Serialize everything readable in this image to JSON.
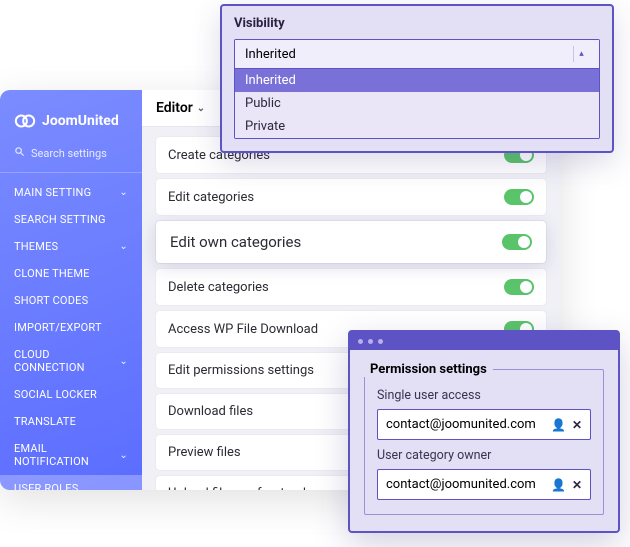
{
  "brand": {
    "name": "JoomUnited"
  },
  "search": {
    "placeholder": "Search settings"
  },
  "sidebar": {
    "items": [
      {
        "label": "MAIN SETTING",
        "hasChildren": true
      },
      {
        "label": "SEARCH SETTING",
        "hasChildren": false
      },
      {
        "label": "THEMES",
        "hasChildren": true
      },
      {
        "label": "CLONE THEME",
        "hasChildren": false
      },
      {
        "label": "SHORT CODES",
        "hasChildren": false
      },
      {
        "label": "IMPORT/EXPORT",
        "hasChildren": false
      },
      {
        "label": "CLOUD CONNECTION",
        "hasChildren": true
      },
      {
        "label": "SOCIAL LOCKER",
        "hasChildren": false
      },
      {
        "label": "TRANSLATE",
        "hasChildren": false
      },
      {
        "label": "EMAIL NOTIFICATION",
        "hasChildren": true
      },
      {
        "label": "USER ROLES",
        "hasChildren": false
      }
    ],
    "selected": "USER ROLES"
  },
  "content": {
    "header": "Editor",
    "permissions": [
      {
        "label": "Create categories",
        "on": true
      },
      {
        "label": "Edit categories",
        "on": true
      },
      {
        "label": "Edit own categories",
        "on": true,
        "highlight": true
      },
      {
        "label": "Delete categories",
        "on": true
      },
      {
        "label": "Access WP File Download",
        "on": true
      },
      {
        "label": "Edit permissions settings",
        "on": false
      },
      {
        "label": "Download files",
        "on": false
      },
      {
        "label": "Preview files",
        "on": false
      },
      {
        "label": "Upload files on frontend",
        "on": false
      }
    ]
  },
  "visibility": {
    "title": "Visibility",
    "selected": "Inherited",
    "options": [
      "Inherited",
      "Public",
      "Private"
    ]
  },
  "permission_panel": {
    "legend": "Permission settings",
    "fields": [
      {
        "label": "Single user access",
        "value": "contact@joomunited.com"
      },
      {
        "label": "User category owner",
        "value": "contact@joomunited.com"
      }
    ]
  }
}
